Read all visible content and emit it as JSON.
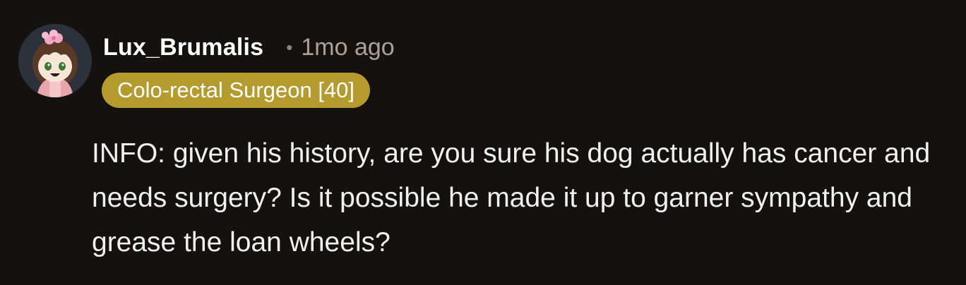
{
  "comment": {
    "author": {
      "username": "Lux_Brumalis",
      "avatar": "cartoon-avatar-pink-bow"
    },
    "separator": "•",
    "timestamp": "1mo ago",
    "flair": {
      "text": "Colo-rectal Surgeon [40]",
      "color": "#b59a2e"
    },
    "body": "INFO: given his history, are you sure his dog actually has cancer and needs surgery? Is it possible he made it up to garner sympathy and grease the loan wheels?"
  },
  "colors": {
    "background": "#14110f",
    "text": "#ffffff",
    "muted": "#a8a29c"
  }
}
